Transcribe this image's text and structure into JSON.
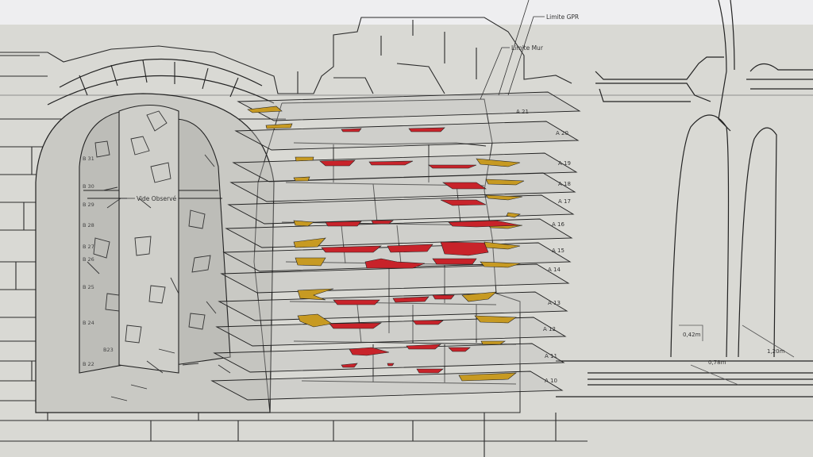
{
  "labels": {
    "limite_gpr": "Limite GPR",
    "limite_mur": "Limite Mur",
    "vide_observe": "Vide Observé"
  },
  "planes_a": [
    "A 21",
    "A 20",
    "A 19",
    "A 18",
    "A 17",
    "A 16",
    "A 15",
    "A 14",
    "A 13",
    "A 12",
    "A 11",
    "A 10"
  ],
  "planes_b": [
    "B 31",
    "B 30",
    "B 29",
    "B 28",
    "B 27",
    "B 26",
    "B 25",
    "B 24",
    "B23",
    "B 22"
  ],
  "dimensions": {
    "d1": "0,42m",
    "d2": "0,78m",
    "d3": "1,20m"
  },
  "colors": {
    "anomaly_red": "#c8232a",
    "anomaly_gold": "#c79a22",
    "stone_fill": "#cfcfca",
    "plane_fill": "#c6c6c3"
  }
}
